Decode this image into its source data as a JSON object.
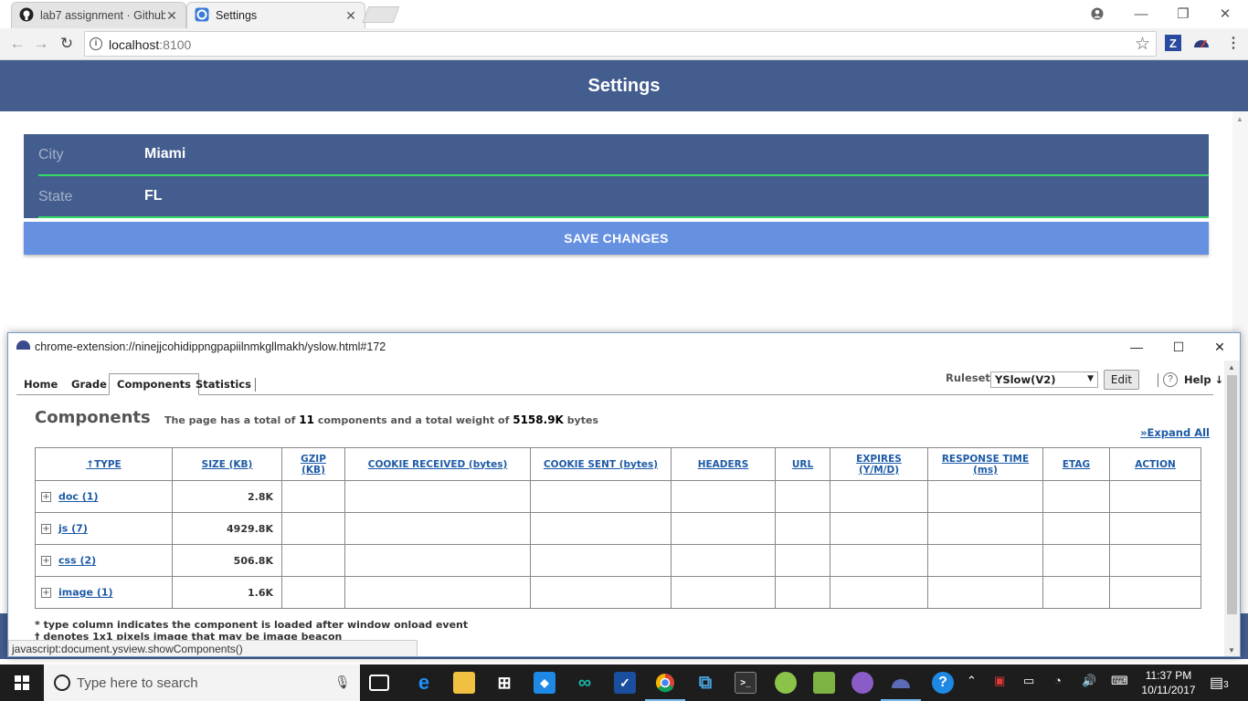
{
  "browser": {
    "tabs": [
      {
        "title": "lab7 assignment · Github",
        "icon": "github-icon",
        "active": false
      },
      {
        "title": "Settings",
        "icon": "chrome-app-icon",
        "active": true
      }
    ],
    "url_host": "localhost",
    "url_port": ":8100"
  },
  "app": {
    "title": "Settings",
    "fields": [
      {
        "label": "City",
        "value": "Miami"
      },
      {
        "label": "State",
        "value": "FL"
      }
    ],
    "save_label": "SAVE CHANGES"
  },
  "popup": {
    "title": "chrome-extension://ninejjcohidippngpapiilnmkgllmakh/yslow.html#172",
    "tabs": [
      "Home",
      "Grade",
      "Components",
      "Statistics"
    ],
    "active_tab": "Components",
    "rulesets_label": "Rulesets",
    "ruleset_value": "YSlow(V2)",
    "edit_label": "Edit",
    "help_label": "Help ↓",
    "heading": "Components",
    "summary_prefix": "The page has a total of",
    "component_count": "11",
    "summary_mid": "components and a total weight of",
    "total_weight": "5158.9K",
    "summary_suffix": "bytes",
    "expand_all": "»Expand All",
    "columns": [
      "↑TYPE",
      "SIZE (KB)",
      "GZIP (KB)",
      "COOKIE RECEIVED (bytes)",
      "COOKIE SENT (bytes)",
      "HEADERS",
      "URL",
      "EXPIRES (Y/M/D)",
      "RESPONSE TIME (ms)",
      "ETAG",
      "ACTION"
    ],
    "rows": [
      {
        "type": "doc (1)",
        "size": "2.8K"
      },
      {
        "type": "js (7)",
        "size": "4929.8K"
      },
      {
        "type": "css (2)",
        "size": "506.8K"
      },
      {
        "type": "image (1)",
        "size": "1.6K"
      }
    ],
    "notes": [
      "* type column indicates the component is loaded after window onload event",
      "† denotes 1x1 pixels image that may be image beacon"
    ],
    "status_text": "javascript:document.ysview.showComponents()"
  },
  "taskbar": {
    "search_placeholder": "Type here to search",
    "time": "11:37 PM",
    "date": "10/11/2017",
    "notification_count": "3"
  },
  "colors": {
    "header": "#435d8e",
    "save_button": "#6690e0",
    "input_underline": "#32db64",
    "yslow_link": "#1d5aa6"
  }
}
